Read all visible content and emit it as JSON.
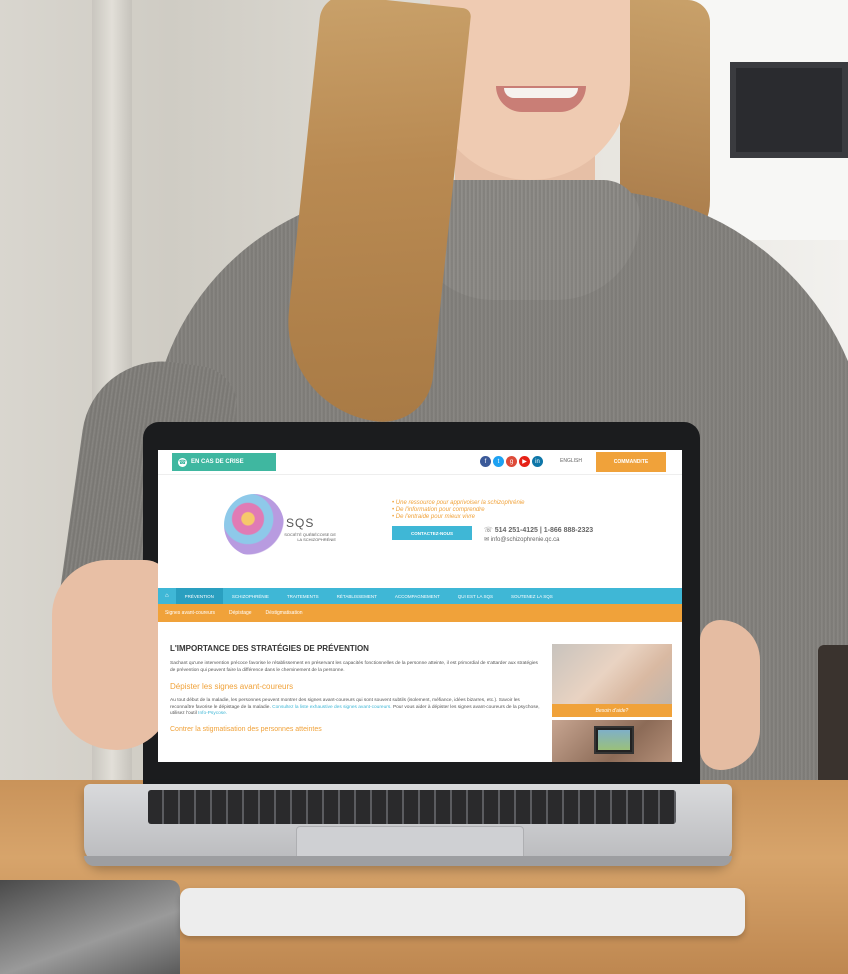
{
  "site": {
    "crisis_label": "EN CAS DE CRISE",
    "crisis_icon": "phone-icon",
    "social_icons": [
      "facebook-icon",
      "twitter-icon",
      "google-plus-icon",
      "youtube-icon",
      "linkedin-icon"
    ],
    "language_link": "ENGLISH",
    "donate_label": "COMMANDITE",
    "logo": {
      "abbr": "SQS",
      "name": "SOCIÉTÉ QUÉBÉCOISE DE LA SCHIZOPHRÉNIE"
    },
    "taglines": [
      "• Une ressource pour apprivoiser la schizophrénie",
      "• De l'information pour comprendre",
      "• De l'entraide pour mieux vivre"
    ],
    "contact_button": "CONTACTEZ-NOUS",
    "phone": "514 251-4125 | 1-866 888-2323",
    "email": "info@schizophrenie.qc.ca",
    "nav": {
      "home_icon": "home-icon",
      "items": [
        "PRÉVENTION",
        "SCHIZOPHRÉNIE",
        "TRAITEMENTS",
        "RÉTABLISSEMENT",
        "ACCOMPAGNEMENT",
        "QUI EST LA SQS",
        "SOUTENEZ LA SQS"
      ]
    },
    "subnav": [
      "Signes avant-coureurs",
      "Dépistage",
      "Déstigmatisation"
    ],
    "content": {
      "title": "L'IMPORTANCE DES STRATÉGIES DE PRÉVENTION",
      "intro": "Sachant qu'une intervention précoce favorise le rétablissement en préservant les capacités fonctionnelles de la personne atteinte, il est primordial de s'attarder aux stratégies de prévention qui peuvent faire la différence dans le cheminement de la personne.",
      "section1_title": "Dépister les signes avant-coureurs",
      "section1_text": "Au tout début de la maladie, les personnes peuvent montrer des signes avant-coureurs qui sont souvent subtils (isolement, méfiance, idées bizarres, etc.). Savoir les reconnaître favorise le dépistage de la maladie.",
      "section1_link1": "Consultez la liste exhaustive des signes avant-coureurs.",
      "section1_text2": "Pour vous aider à dépister les signes avant-coureurs de la psychose, utilisez l'outil",
      "section1_link2": "Info-Psycose.",
      "section2_title": "Contrer la stigmatisation des personnes atteintes"
    },
    "sidebar": {
      "help_label": "Besoin d'aide?"
    }
  }
}
